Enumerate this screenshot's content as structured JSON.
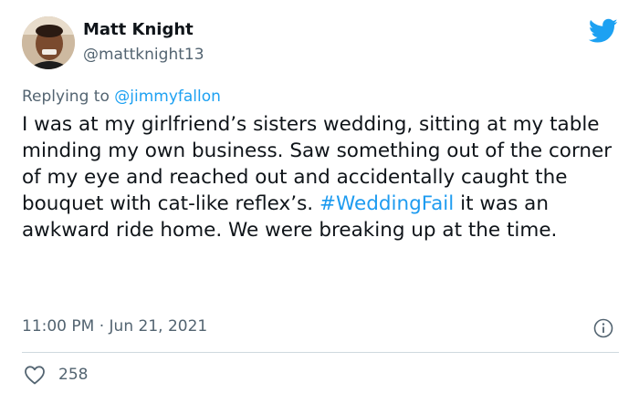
{
  "author": {
    "name": "Matt Knight",
    "handle": "@mattknight13"
  },
  "reply": {
    "prefix": "Replying to",
    "mention": "@jimmyfallon"
  },
  "tweet": {
    "text_before": "I was at my girlfriend’s sisters wedding, sitting at my table minding my own business. Saw something out of the corner of my eye and reached out and accidentally caught the bouquet with cat-like reflex’s.",
    "hashtag": "#WeddingFail",
    "text_after": "it was an awkward ride home. We were breaking up at the time."
  },
  "meta": {
    "time": "11:00 PM",
    "separator": "·",
    "date": "Jun 21, 2021"
  },
  "engagement": {
    "likes": "258"
  },
  "icons": {
    "brand": "twitter-bird-icon",
    "info": "info-icon",
    "like": "heart-icon"
  },
  "colors": {
    "brand_blue": "#1da1f2",
    "link_blue": "#1d9bf0",
    "muted": "#536471",
    "text": "#0f1419"
  }
}
